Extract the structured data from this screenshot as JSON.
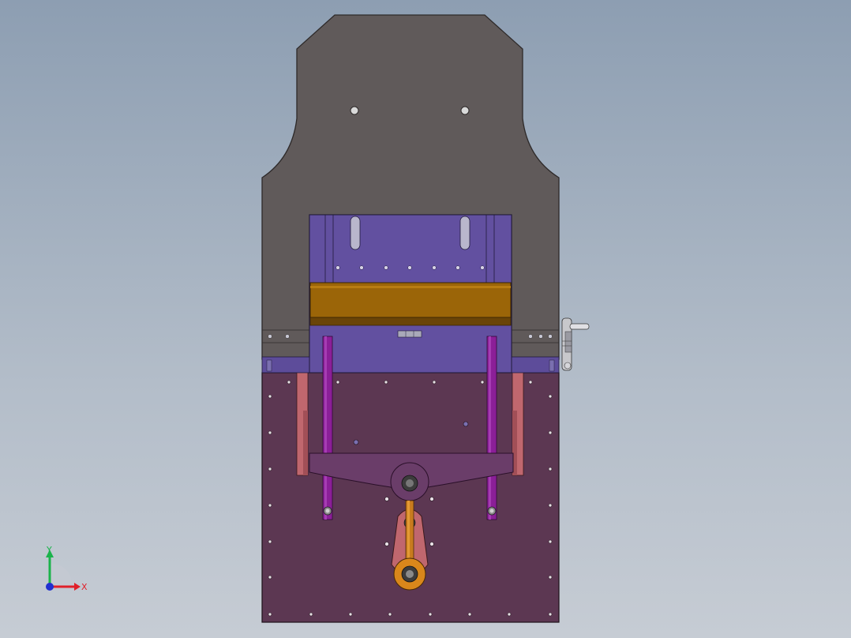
{
  "viewport": {
    "background_top": "#8d9eb2",
    "background_bottom": "#c6ccd4"
  },
  "model": {
    "colors": {
      "frame": "#605a5a",
      "frame_edge": "#2e2a2a",
      "slide": "#6250a0",
      "die_block": "#9b6508",
      "base": "#5c3752",
      "guide_rod": "#8b1f98",
      "side_column": "#c0676e",
      "linkage": "#6a3d69",
      "connecting_rod": "#c87b1e",
      "handwheel": "#c8c8cc"
    }
  },
  "triad": {
    "x_label": "X",
    "y_label": "Y",
    "x_color": "#e0202a",
    "y_color": "#1bb34b",
    "z_color": "#2030d0"
  }
}
